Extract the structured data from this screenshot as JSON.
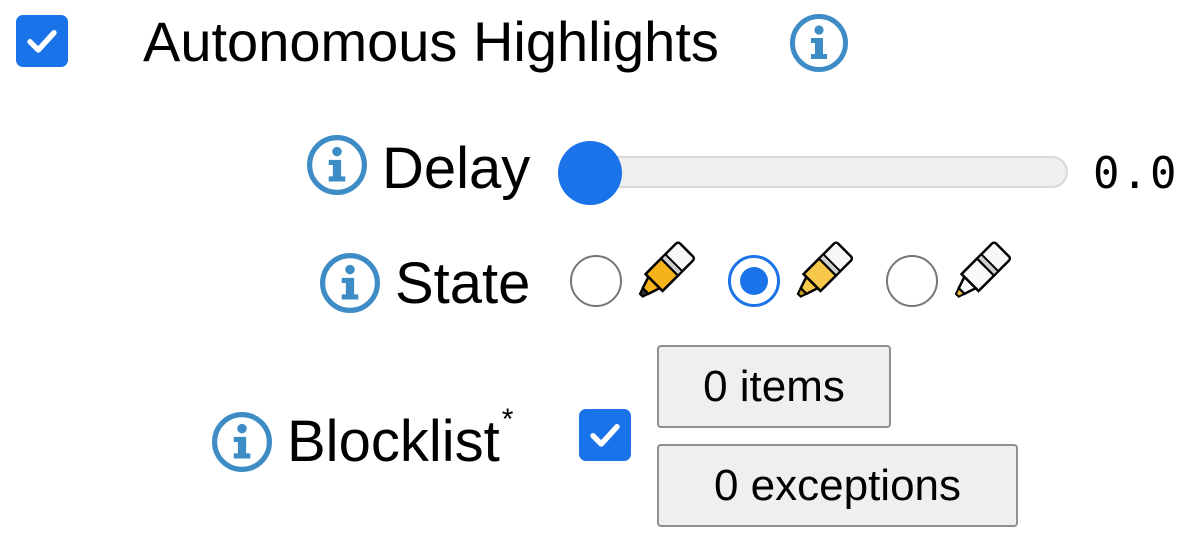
{
  "autonomous_highlights": {
    "checked": true,
    "title": "Autonomous Highlights"
  },
  "delay": {
    "label": "Delay",
    "value": 0.0,
    "value_text": "0.0"
  },
  "state": {
    "label": "State",
    "selected_index": 1,
    "options": [
      {
        "icon": "yellow-highlighter-icon",
        "checked": false
      },
      {
        "icon": "light-yellow-highlighter-icon",
        "checked": true
      },
      {
        "icon": "white-highlighter-icon",
        "checked": false
      }
    ]
  },
  "blocklist": {
    "label": "Blocklist",
    "asterisk": "*",
    "checked": true,
    "items_button": "0 items",
    "exceptions_button": "0 exceptions"
  },
  "colors": {
    "accent": "#1a73e8",
    "info_icon": "#3d8cc6",
    "button_bg": "#efefef",
    "track_bg": "#efefef"
  }
}
